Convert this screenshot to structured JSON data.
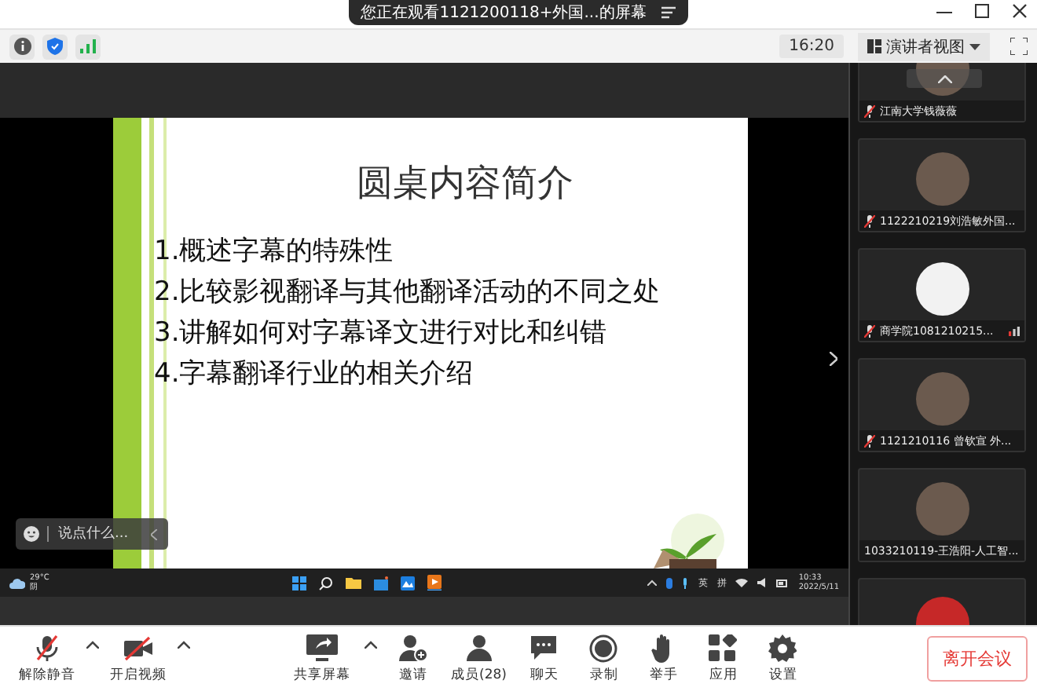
{
  "title_bar": {
    "banner": "您正在观看1121200118+外国...的屏幕"
  },
  "toolbar": {
    "time": "16:20",
    "view_button": "演讲者视图"
  },
  "shared_screen": {
    "slide": {
      "title": "圆桌内容简介",
      "items": [
        "1.概述字幕的特殊性",
        "2.比较影视翻译与其他翻译活动的不同之处",
        "3.讲解如何对字幕译文进行对比和纠错",
        "4.字幕翻译行业的相关介绍"
      ]
    },
    "chat_input": {
      "placeholder": "说点什么..."
    },
    "taskbar": {
      "temperature": "29°C",
      "weather": "阴",
      "input_methods": [
        "英",
        "拼"
      ],
      "time": "10:33",
      "date": "2022/5/11"
    }
  },
  "participants": [
    {
      "kind": "photo",
      "name": "江南大学钱薇薇",
      "muted": true,
      "signal_weak": false
    },
    {
      "kind": "photo",
      "name": "1122210219刘浩敏外国...",
      "muted": true,
      "signal_weak": false
    },
    {
      "kind": "sketch",
      "name": "商学院1081210215...",
      "muted": true,
      "signal_weak": true
    },
    {
      "kind": "photo",
      "name": "1121210116 曾钦宣 外...",
      "muted": true,
      "signal_weak": false
    },
    {
      "kind": "photo",
      "name": "1033210119-王浩阳-人工智...",
      "muted": false,
      "signal_weak": false
    },
    {
      "kind": "red"
    }
  ],
  "bottom_bar": {
    "left_items": [
      {
        "kind": "mic-muted",
        "label": "解除静音",
        "caret": true
      },
      {
        "kind": "video-off",
        "label": "开启视频",
        "caret": true
      }
    ],
    "center_items": [
      {
        "kind": "share",
        "label": "共享屏幕",
        "caret": true
      },
      {
        "kind": "invite",
        "label": "邀请",
        "caret": false
      },
      {
        "kind": "members",
        "label": "成员(28)",
        "caret": false
      },
      {
        "kind": "chat",
        "label": "聊天",
        "caret": false
      },
      {
        "kind": "record",
        "label": "录制",
        "caret": false
      },
      {
        "kind": "hand",
        "label": "举手",
        "caret": false
      },
      {
        "kind": "apps",
        "label": "应用",
        "caret": false
      },
      {
        "kind": "settings",
        "label": "设置",
        "caret": false
      }
    ],
    "leave_button": "离开会议"
  }
}
